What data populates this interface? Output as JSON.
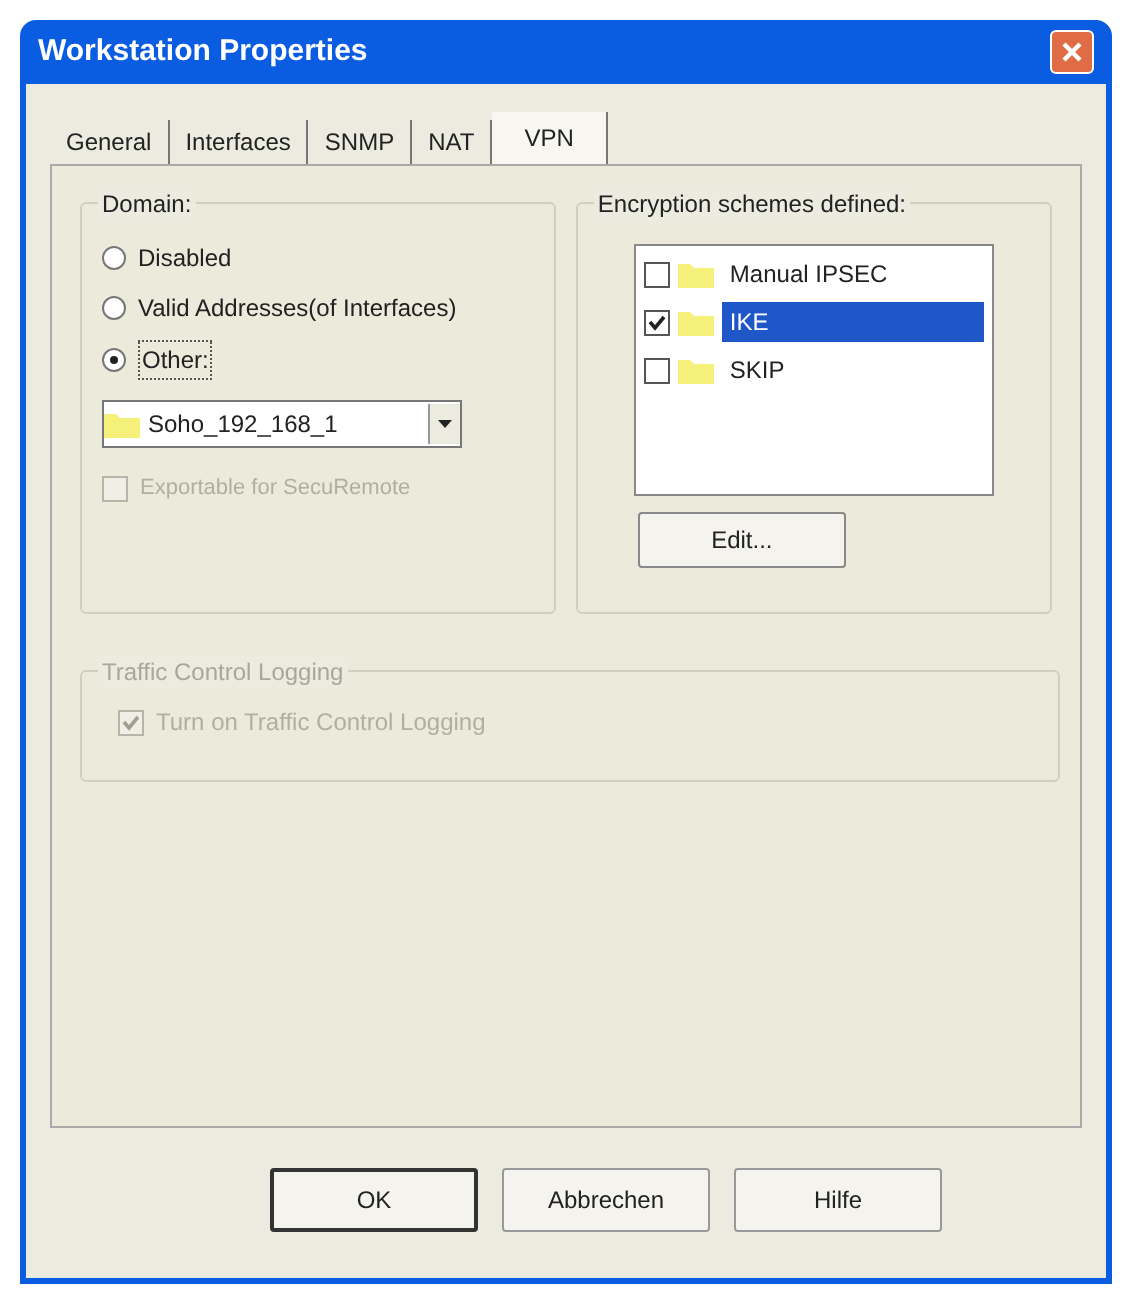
{
  "window": {
    "title": "Workstation Properties"
  },
  "tabs": [
    {
      "label": "General",
      "selected": false
    },
    {
      "label": "Interfaces",
      "selected": false
    },
    {
      "label": "SNMP",
      "selected": false
    },
    {
      "label": "NAT",
      "selected": false
    },
    {
      "label": "VPN",
      "selected": true
    }
  ],
  "domain": {
    "label": "Domain:",
    "options": [
      {
        "label": "Disabled",
        "selected": false
      },
      {
        "label": "Valid Addresses(of Interfaces)",
        "selected": false
      },
      {
        "label": "Other:",
        "selected": true
      }
    ],
    "combo": {
      "value": "Soho_192_168_1"
    },
    "exportable": {
      "label": "Exportable for SecuRemote",
      "checked": false,
      "disabled": true
    }
  },
  "encryption": {
    "label": "Encryption schemes defined:",
    "items": [
      {
        "label": "Manual IPSEC",
        "checked": false,
        "selected": false
      },
      {
        "label": "IKE",
        "checked": true,
        "selected": true
      },
      {
        "label": "SKIP",
        "checked": false,
        "selected": false
      }
    ],
    "edit_button": "Edit..."
  },
  "traffic": {
    "label": "Traffic Control Logging",
    "disabled": true,
    "checkbox": {
      "label": "Turn on Traffic Control Logging",
      "checked": true
    }
  },
  "buttons": [
    {
      "label": "OK",
      "default": true
    },
    {
      "label": "Abbrechen",
      "default": false
    },
    {
      "label": "Hilfe",
      "default": false
    }
  ]
}
